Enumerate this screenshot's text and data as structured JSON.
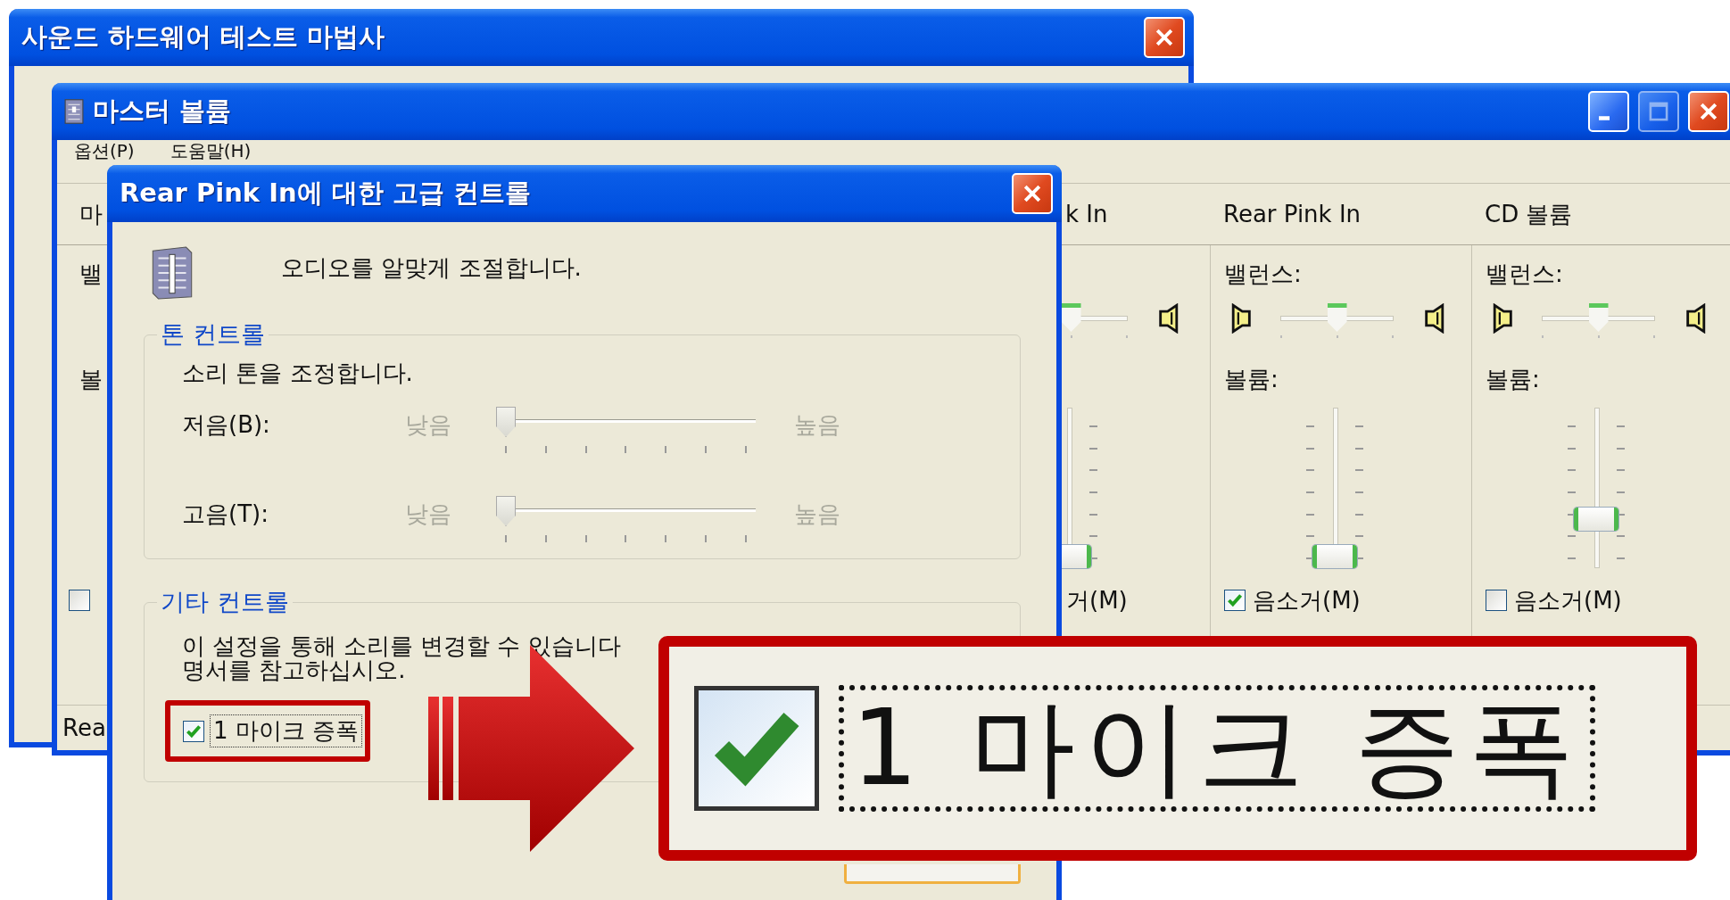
{
  "wizard_window": {
    "title": "사운드 하드웨어 테스트 마법사"
  },
  "master_window": {
    "title": "마스터 볼륨",
    "title_buttons": [
      {
        "kind": "minimize",
        "disabled": false
      },
      {
        "kind": "maximize",
        "disabled": true
      },
      {
        "kind": "close",
        "disabled": false
      }
    ],
    "menu": [
      "옵션(P)",
      "도움말(H)"
    ],
    "columns": [
      {
        "kind": "stub",
        "header": "마",
        "balance_label": "밸",
        "volume_label": "볼",
        "mute": {
          "checked": false
        }
      },
      {
        "kind": "cut",
        "header": "k In",
        "balance": {
          "level": 0.5
        },
        "volume": {
          "level": 0
        },
        "mute": {
          "label": "거(M)"
        }
      },
      {
        "kind": "full",
        "header": "Rear Pink In",
        "balance_label": "밸런스:",
        "balance": {
          "level": 0.5
        },
        "volume_label": "볼륨:",
        "volume": {
          "level": 0
        },
        "mute": {
          "label": "음소거(M)",
          "checked": true
        }
      },
      {
        "kind": "full",
        "header": "CD 볼륨",
        "balance_label": "밸런스:",
        "balance": {
          "level": 0.5
        },
        "volume_label": "볼륨:",
        "volume": {
          "level": 0.27
        },
        "mute": {
          "label": "음소거(M)",
          "checked": false
        }
      }
    ],
    "status_bar": "Rea"
  },
  "dialog": {
    "title": "Rear Pink In에 대한 고급 컨트롤",
    "intro": "오디오를 알맞게 조절합니다.",
    "tone_group": {
      "label": "톤 컨트롤",
      "description": "소리 톤을 조정합니다.",
      "sliders": [
        {
          "label": "저음(B):",
          "low": "낮음",
          "high": "높음",
          "level": 0
        },
        {
          "label": "고음(T):",
          "low": "낮음",
          "high": "높음",
          "level": 0
        }
      ]
    },
    "other_group": {
      "label": "기타 컨트롤",
      "lines": [
        "이 설정을 통해 소리를 변경할 수 있습니다",
        "명서를 참고하십시오."
      ],
      "checkbox": {
        "label": "1 마이크 증폭",
        "checked": true,
        "highlighted": true
      }
    }
  },
  "callout": {
    "checkbox": {
      "label": "1 마이크 증폭",
      "checked": true
    }
  }
}
